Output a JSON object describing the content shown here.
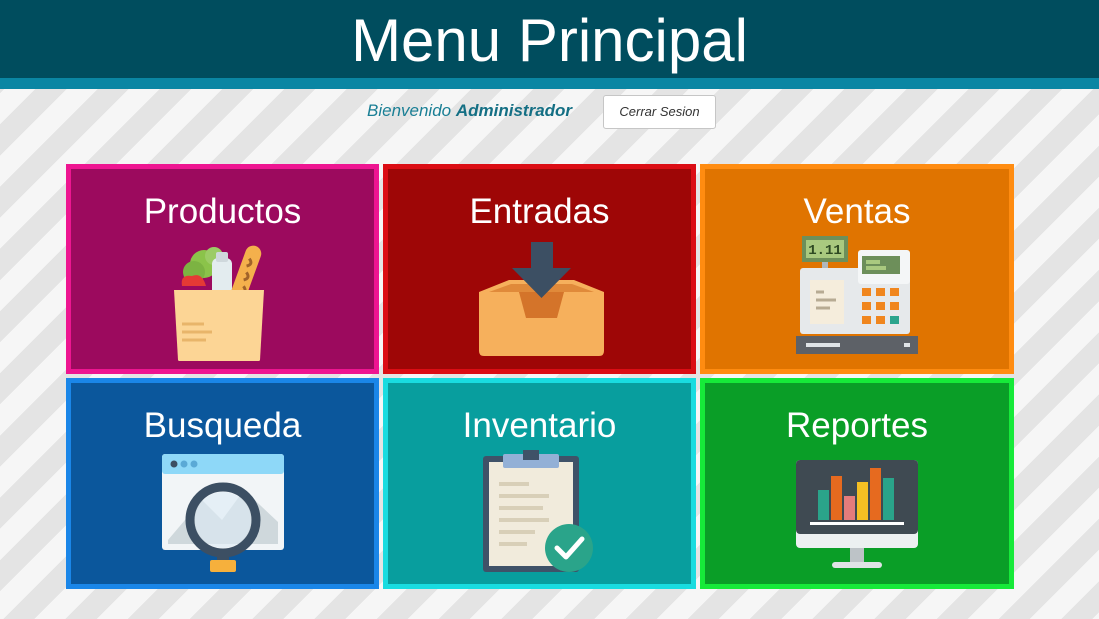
{
  "header": {
    "title": "Menu Principal"
  },
  "session": {
    "welcome_text": "Bienvenido",
    "username": "Administrador",
    "logout_label": "Cerrar Sesion"
  },
  "menu": {
    "tiles": [
      {
        "label": "Productos",
        "icon": "grocery-bag-icon",
        "color": "#9c0a5e",
        "border": "#ee1591"
      },
      {
        "label": "Entradas",
        "icon": "inbox-tray-icon",
        "color": "#9e0606",
        "border": "#db0d14"
      },
      {
        "label": "Ventas",
        "icon": "cash-register-icon",
        "color": "#e07400",
        "border": "#ff8c11"
      },
      {
        "label": "Busqueda",
        "icon": "magnifier-window-icon",
        "color": "#0b579c",
        "border": "#1a86e8"
      },
      {
        "label": "Inventario",
        "icon": "clipboard-check-icon",
        "color": "#089e9e",
        "border": "#19dce0"
      },
      {
        "label": "Reportes",
        "icon": "bar-chart-monitor-icon",
        "color": "#0a9e27",
        "border": "#16ea39"
      }
    ],
    "register_display": "1.11"
  }
}
